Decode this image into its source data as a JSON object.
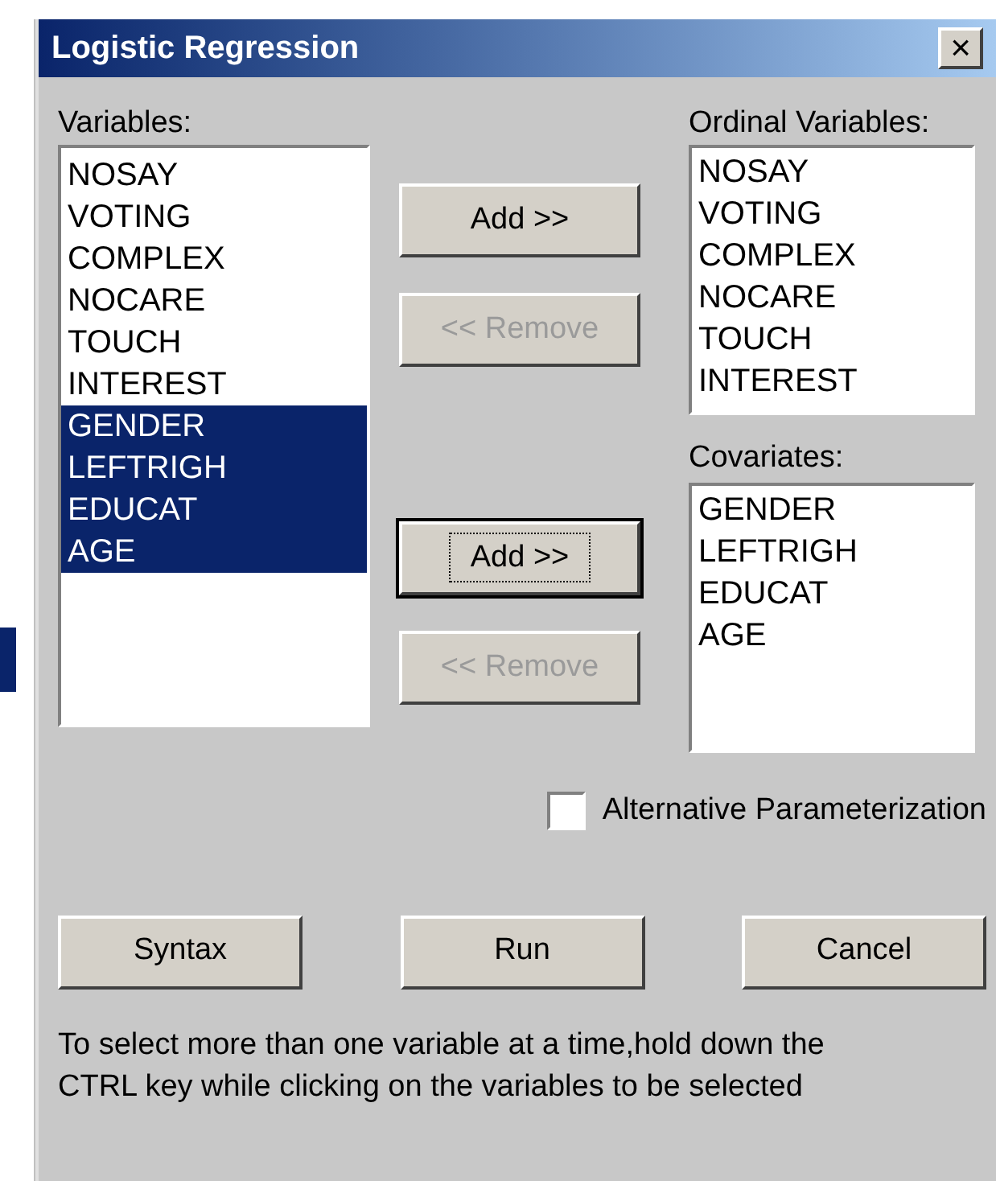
{
  "window": {
    "title": "Logistic Regression",
    "close": "×"
  },
  "variables": {
    "label": "Variables:",
    "items": [
      {
        "name": "NOSAY",
        "selected": false
      },
      {
        "name": "VOTING",
        "selected": false
      },
      {
        "name": "COMPLEX",
        "selected": false
      },
      {
        "name": "NOCARE",
        "selected": false
      },
      {
        "name": "TOUCH",
        "selected": false
      },
      {
        "name": "INTEREST",
        "selected": false
      },
      {
        "name": "GENDER",
        "selected": true
      },
      {
        "name": "LEFTRIGH",
        "selected": true
      },
      {
        "name": "EDUCAT",
        "selected": true
      },
      {
        "name": "AGE",
        "selected": true
      }
    ]
  },
  "ordinal_buttons": [
    {
      "label": "Add >>",
      "disabled": false,
      "focused": false
    },
    {
      "label": "<< Remove",
      "disabled": true,
      "focused": false
    }
  ],
  "covariate_buttons": [
    {
      "label": "Add >>",
      "disabled": false,
      "focused": true
    },
    {
      "label": "<< Remove",
      "disabled": true,
      "focused": false
    }
  ],
  "ordinal_variables": {
    "label": "Ordinal Variables:",
    "items": [
      "NOSAY",
      "VOTING",
      "COMPLEX",
      "NOCARE",
      "TOUCH",
      "INTEREST"
    ]
  },
  "covariates": {
    "label": "Covariates:",
    "items": [
      "GENDER",
      "LEFTRIGH",
      "EDUCAT",
      "AGE"
    ]
  },
  "alternative_parameterization": {
    "label": "Alternative Parameterization",
    "checked": false
  },
  "buttons": [
    {
      "label": "Syntax"
    },
    {
      "label": "Run"
    },
    {
      "label": "Cancel"
    }
  ],
  "hint": "To select more than one variable at a time,hold down the CTRL key while clicking on the variables to be selected"
}
